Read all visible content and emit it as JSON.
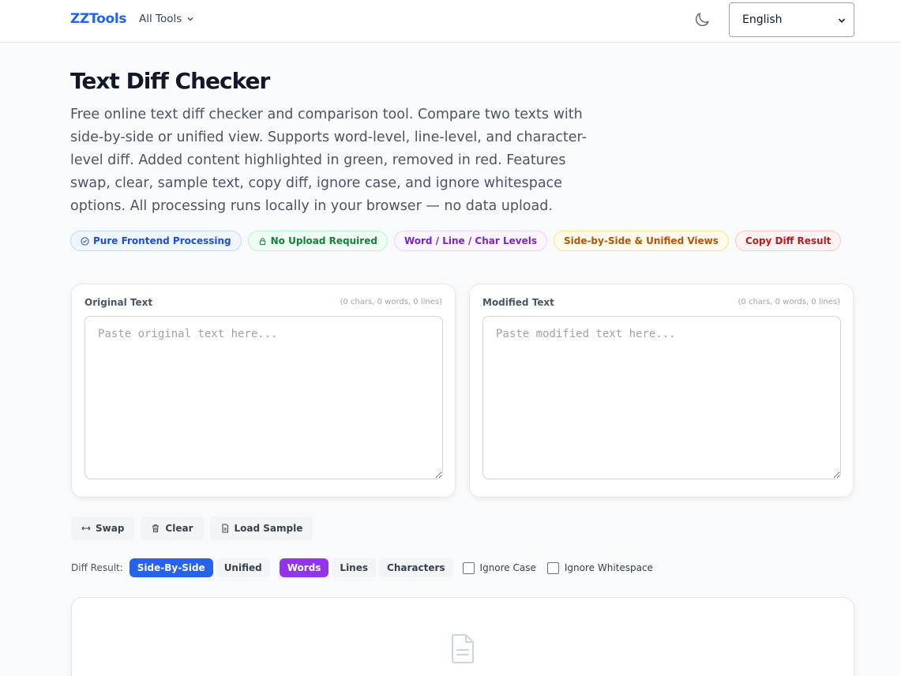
{
  "header": {
    "brand": "ZZTools",
    "all_tools_label": "All Tools",
    "language_selected": "English"
  },
  "page": {
    "title": "Text Diff Checker",
    "description": "Free online text diff checker and comparison tool. Compare two texts with side-by-side or unified view. Supports word-level, line-level, and character-level diff. Added content highlighted in green, removed in red. Features swap, clear, sample text, copy diff, ignore case, and ignore whitespace options. All processing runs locally in your browser — no data upload."
  },
  "badges": [
    {
      "label": "Pure Frontend Processing",
      "icon": "check-circle-icon",
      "color": "#1d4ed8"
    },
    {
      "label": "No Upload Required",
      "icon": "lock-icon",
      "color": "#15803d"
    },
    {
      "label": "Word / Line / Char Levels",
      "color": "#7e22ce"
    },
    {
      "label": "Side-by-Side & Unified Views",
      "color": "#b45309"
    },
    {
      "label": "Copy Diff Result",
      "color": "#b91c1c"
    }
  ],
  "original": {
    "label": "Original Text",
    "stats": "(0 chars, 0 words, 0 lines)",
    "placeholder": "Paste original text here..."
  },
  "modified": {
    "label": "Modified Text",
    "stats": "(0 chars, 0 words, 0 lines)",
    "placeholder": "Paste modified text here..."
  },
  "actions": {
    "swap": "Swap",
    "clear": "Clear",
    "load_sample": "Load Sample"
  },
  "options": {
    "label": "Diff Result:",
    "view_side_by_side": "Side-By-Side",
    "view_unified": "Unified",
    "level_words": "Words",
    "level_lines": "Lines",
    "level_characters": "Characters",
    "ignore_case": "Ignore Case",
    "ignore_whitespace": "Ignore Whitespace",
    "active_view": "Side-By-Side",
    "active_level": "Words"
  },
  "colors": {
    "brand": "#2563eb",
    "active_view": "#2563eb",
    "active_level": "#9333ea"
  }
}
